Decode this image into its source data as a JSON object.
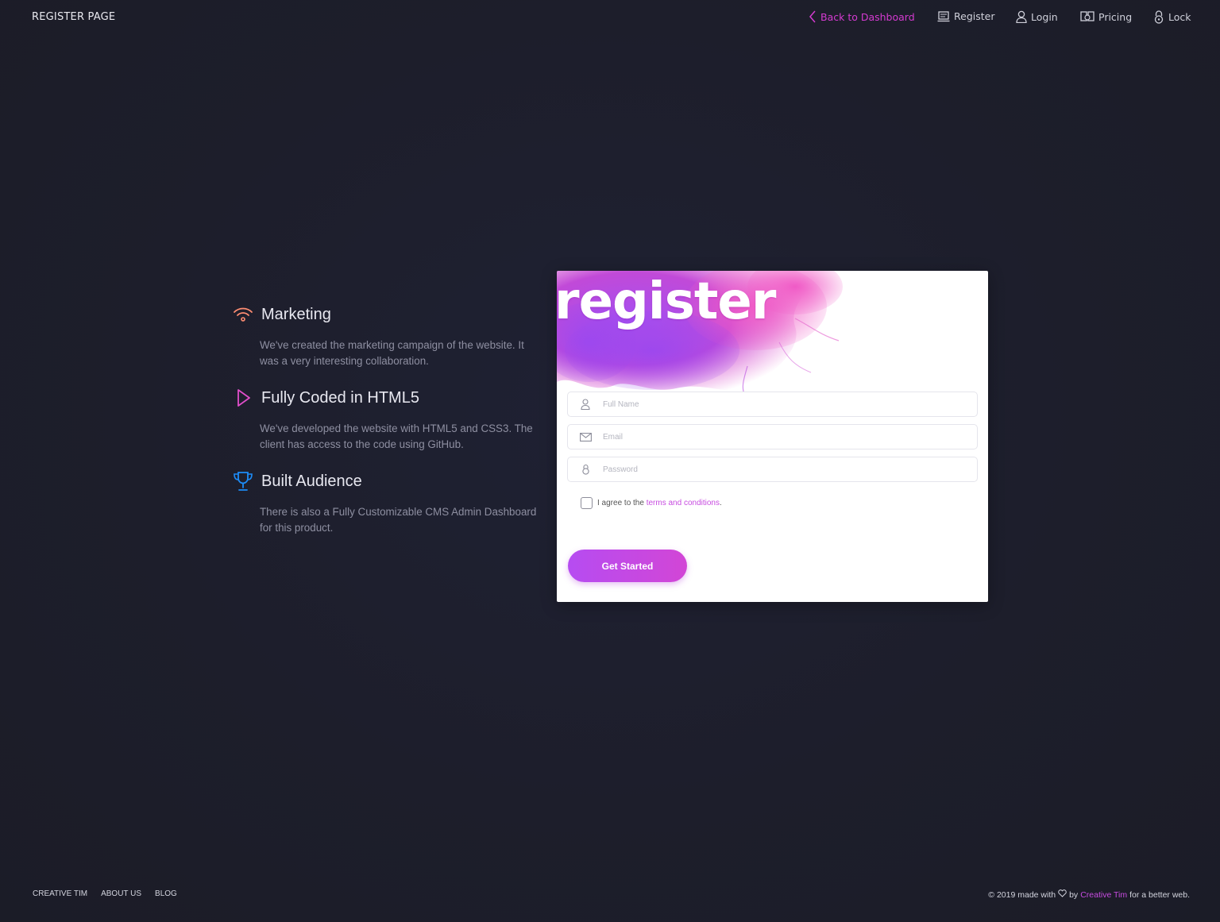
{
  "navbar": {
    "brand": "REGISTER PAGE",
    "back_label": "Back to Dashboard",
    "items": [
      {
        "label": "Register",
        "icon": "laptop-icon"
      },
      {
        "label": "Login",
        "icon": "user-icon"
      },
      {
        "label": "Pricing",
        "icon": "money-icon"
      },
      {
        "label": "Lock",
        "icon": "lock-icon"
      }
    ]
  },
  "info": [
    {
      "title": "Marketing",
      "description": "We've created the marketing campaign of the website. It was a very interesting collaboration.",
      "icon": "wifi-icon",
      "color": "#ff8d72"
    },
    {
      "title": "Fully Coded in HTML5",
      "description": "We've developed the website with HTML5 and CSS3. The client has access to the code using GitHub.",
      "icon": "triangle-right-icon",
      "color": "#e14eca"
    },
    {
      "title": "Built Audience",
      "description": "There is also a Fully Customizable CMS Admin Dashboard for this product.",
      "icon": "trophy-icon",
      "color": "#1d8cf8"
    }
  ],
  "card": {
    "title": "register",
    "fields": {
      "full_name_placeholder": "Full Name",
      "email_placeholder": "Email",
      "password_placeholder": "Password"
    },
    "agree_text": "I agree to the",
    "agree_link": "terms and conditions",
    "agree_end": ".",
    "button": "Get Started"
  },
  "footer": {
    "links": [
      "CREATIVE TIM",
      "ABOUT US",
      "BLOG"
    ],
    "copyright_pre": "© 2019 made with",
    "copyright_by": "by",
    "copyright_brand": "Creative Tim",
    "copyright_post": "for a better web."
  },
  "colors": {
    "background": "#1e1e2c",
    "accent": "#e14eca",
    "button": "#c04ae6"
  }
}
